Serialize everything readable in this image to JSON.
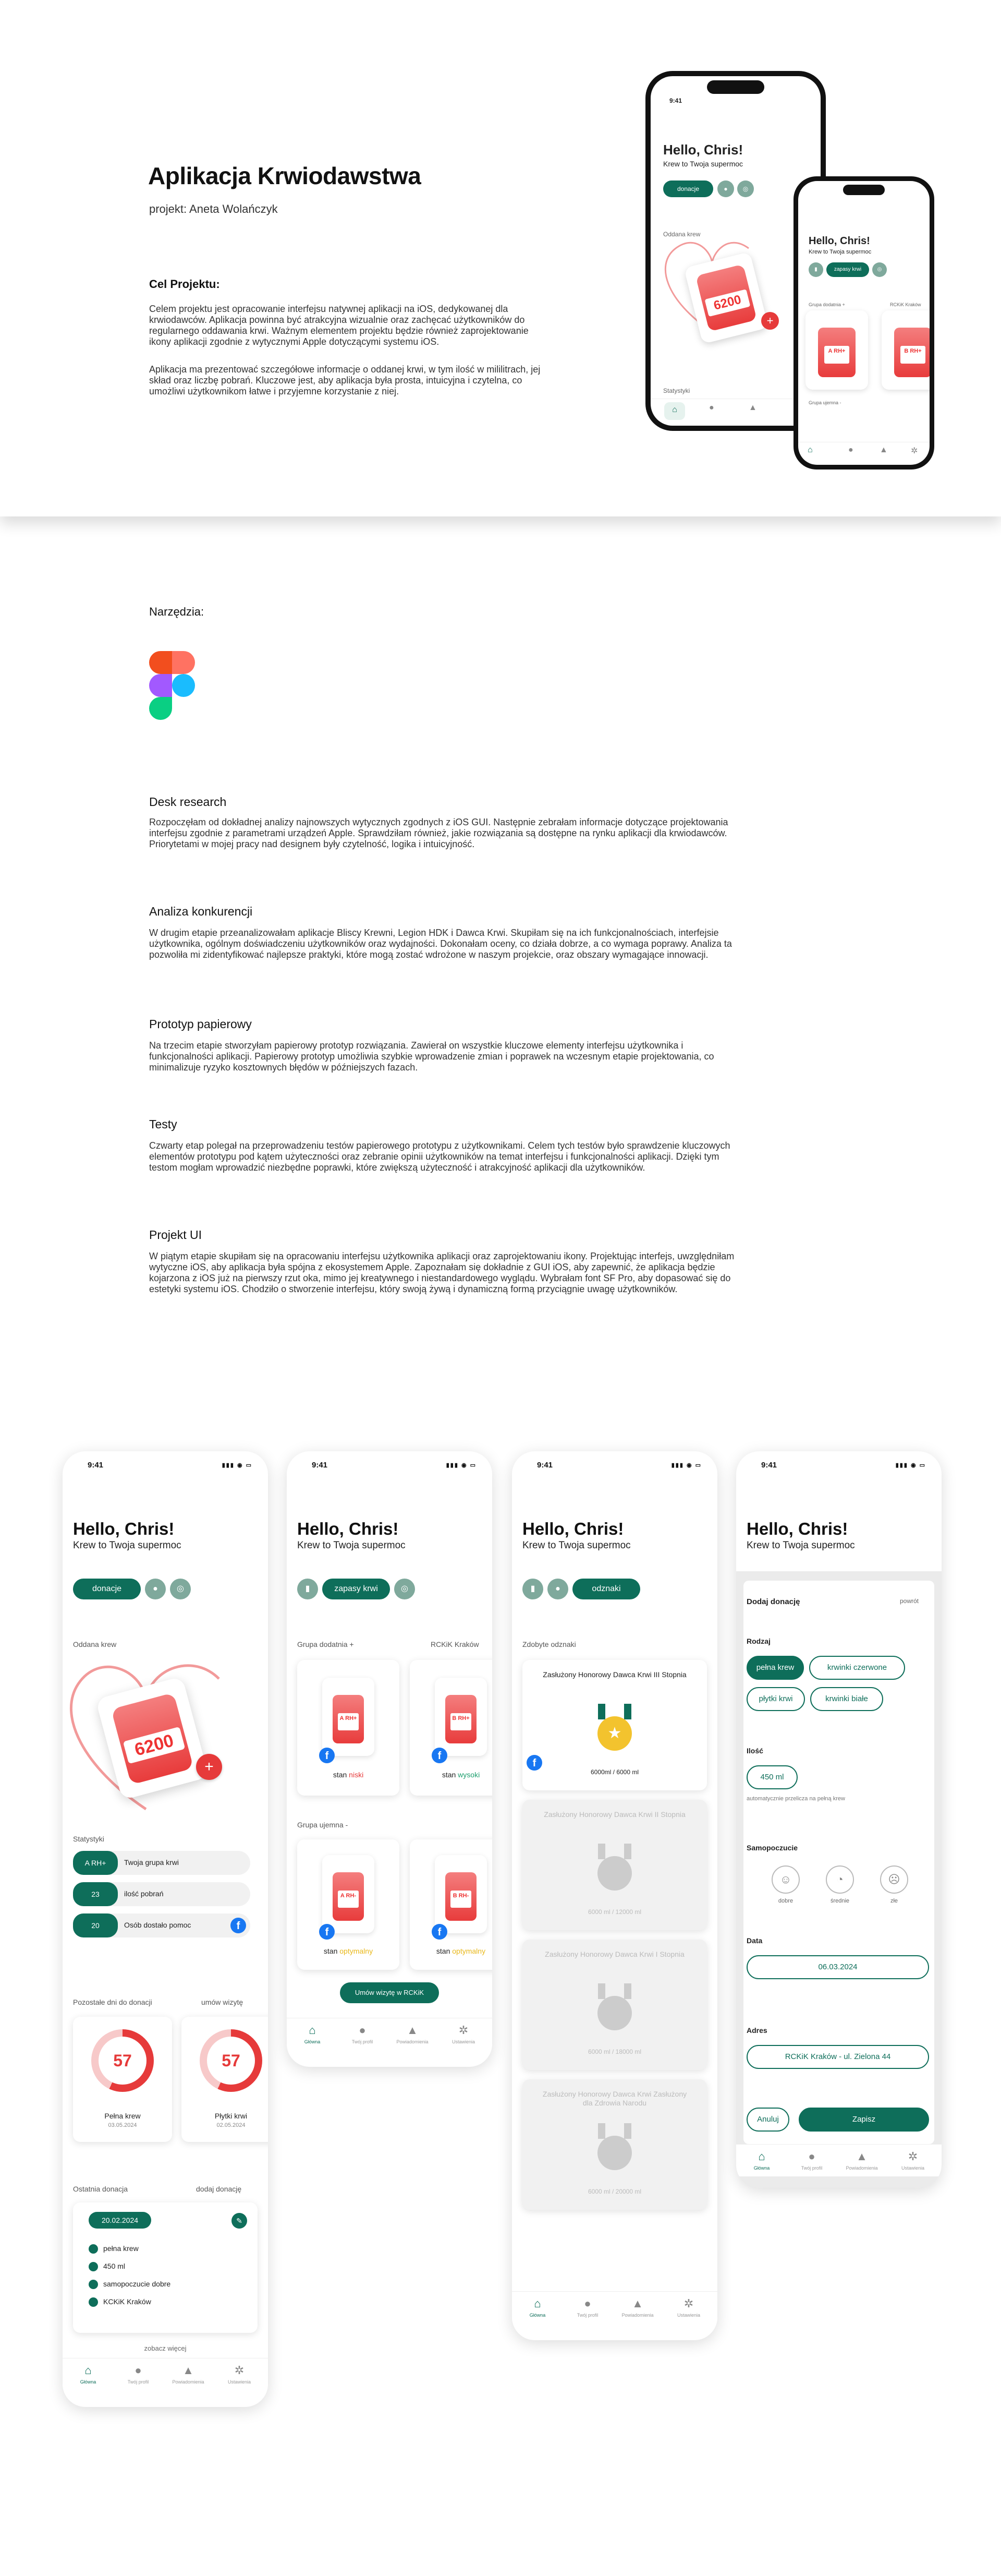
{
  "hero": {
    "title": "Aplikacja Krwiodawstwa",
    "author": "projekt: Aneta Wolańczyk",
    "goal_heading": "Cel Projektu:",
    "goal_text": "Celem projektu jest opracowanie interfejsu natywnej aplikacji na iOS, dedykowanej dla krwiodawców. Aplikacja powinna być atrakcyjna wizualnie oraz zachęcać użytkowników do regularnego oddawania krwi. Ważnym elementem projektu będzie również zaprojektowanie ikony aplikacji zgodnie z wytycznymi Apple dotyczącymi systemu iOS.",
    "goal_text2": "Aplikacja ma prezentować szczegółowe informacje o oddanej krwi, w tym ilość w mililitrach, jej skład oraz liczbę pobrań. Kluczowe jest, aby aplikacja była prosta, intuicyjna i czytelna, co umożliwi użytkownikom łatwe i przyjemne korzystanie z niej."
  },
  "tools": {
    "heading": "Narzędzia:"
  },
  "sections": [
    {
      "title": "Desk research",
      "text": "Rozpoczęłam od dokładnej analizy najnowszych wytycznych zgodnych z iOS GUI. Następnie zebrałam informacje dotyczące projektowania interfejsu zgodnie z parametrami urządzeń Apple. Sprawdziłam również, jakie rozwiązania są dostępne na rynku aplikacji dla krwiodawców. Priorytetami w mojej pracy nad designem były czytelność, logika i intuicyjność."
    },
    {
      "title": "Analiza konkurencji",
      "text": "W drugim etapie przeanalizowałam aplikacje Bliscy Krewni, Legion HDK i Dawca Krwi. Skupiłam się na ich funkcjonalnościach, interfejsie użytkownika, ogólnym doświadczeniu użytkowników oraz wydajności. Dokonałam oceny, co działa dobrze, a co wymaga poprawy. Analiza ta pozwoliła mi zidentyfikować najlepsze praktyki, które mogą zostać wdrożone w naszym projekcie, oraz obszary wymagające innowacji."
    },
    {
      "title": "Prototyp papierowy",
      "text": "Na trzecim etapie stworzyłam papierowy prototyp rozwiązania. Zawierał on wszystkie kluczowe elementy interfejsu użytkownika i funkcjonalności aplikacji. Papierowy prototyp umożliwia szybkie wprowadzenie zmian i poprawek na wczesnym etapie projektowania, co minimalizuje ryzyko kosztownych błędów w późniejszych fazach."
    },
    {
      "title": "Testy",
      "text": "Czwarty etap polegał na przeprowadzeniu testów papierowego prototypu z użytkownikami. Celem tych testów było sprawdzenie kluczowych elementów prototypu pod kątem użyteczności oraz zebranie opinii użytkowników na temat interfejsu i funkcjonalności aplikacji. Dzięki tym testom mogłam wprowadzić niezbędne poprawki, które zwiększą użyteczność i atrakcyjność aplikacji dla użytkowników."
    },
    {
      "title": "Projekt UI",
      "text": "W piątym etapie skupiłam się na opracowaniu interfejsu użytkownika aplikacji oraz zaprojektowaniu ikony. Projektując interfejs, uwzględniłam wytyczne iOS, aby aplikacja była spójna z ekosystemem Apple. Zapoznałam się dokładnie z GUI iOS, aby zapewnić, że aplikacja będzie kojarzona z iOS już na pierwszy rzut oka, mimo jej kreatywnego i niestandardowego wyglądu. Wybrałam font SF Pro, aby dopasować się do estetyki systemu iOS. Chodziło o stworzenie interfejsu, który swoją żywą i dynamiczną formą przyciągnie uwagę użytkowników."
    }
  ],
  "app": {
    "time": "9:41",
    "hello": "Hello, Chris!",
    "tagline": "Krew to Twoja supermoc",
    "btn_donate": "donacje",
    "btn_stocks": "zapasy krwi",
    "btn_badges": "odznaki",
    "donated": "Oddana krew",
    "donated_value": "6200",
    "donated_unit": "ml",
    "stats": "Statystyki",
    "stat_rows": [
      {
        "v": "A RH+",
        "l": "Twoja grupa krwi"
      },
      {
        "v": "23",
        "l": "ilość pobrań"
      },
      {
        "v": "20",
        "l": "Osób dostało pomoc"
      }
    ],
    "days_left": "Pozostałe dni do donacji",
    "remind": "umów wizytę",
    "gauges": [
      {
        "v": "57",
        "l": "Pełna krew",
        "d": "03.05.2024"
      },
      {
        "v": "57",
        "l": "Płytki krwi",
        "d": "02.05.2024"
      }
    ],
    "last": "Ostatnia donacja",
    "add": "dodaj donację",
    "last_date": "20.02.2024",
    "last_rows": [
      "pełna krew",
      "450 ml",
      "samopoczucie dobre",
      "KCKiK Kraków"
    ],
    "more": "zobacz więcej",
    "tabs": [
      "Główna",
      "Twój profil",
      "Powiadomienia",
      "Ustawienia"
    ],
    "grp_pos": "Grupa dodatnia +",
    "grp_neg": "Grupa ujemna -",
    "center": "RCKiK Kraków",
    "blood": [
      {
        "t": "A RH+",
        "s": "niski",
        "c": "#e63a3a"
      },
      {
        "t": "B RH+",
        "s": "wysoki",
        "c": "#1d9f6e"
      },
      {
        "t": "A RH-",
        "s": "optymalny",
        "c": "#e9b81a"
      },
      {
        "t": "B RH-",
        "s": "optymalny",
        "c": "#e9b81a"
      }
    ],
    "stan": "stan",
    "book_rckik": "Umów wizytę w RCKiK",
    "badges_h": "Zdobyte odznaki",
    "badges": [
      {
        "title": "Zasłużony Honorowy Dawca Krwi III Stopnia",
        "p": "6000ml / 6000 ml",
        "on": true
      },
      {
        "title": "Zasłużony Honorowy Dawca Krwi II Stopnia",
        "p": "6000 ml / 12000 ml",
        "on": false
      },
      {
        "title": "Zasłużony Honorowy Dawca Krwi I Stopnia",
        "p": "6000 ml / 18000 ml",
        "on": false
      },
      {
        "title": "Zasłużony Honorowy Dawca Krwi Zasłużony dla Zdrowia Narodu",
        "p": "6000 ml / 20000 ml",
        "on": false
      }
    ],
    "form_title": "Dodaj donację",
    "form_back": "powrót",
    "kind": "Rodzaj",
    "kinds": [
      "pełna krew",
      "krwinki czerwone",
      "płytki krwi",
      "krwinki białe"
    ],
    "amount": "Ilość",
    "amount_v": "450 ml",
    "amount_hint": "automatycznie przelicza na pełną krew",
    "mood": "Samopoczucie",
    "moods": [
      "dobre",
      "średnie",
      "złe"
    ],
    "date": "Data",
    "date_v": "06.03.2024",
    "addr": "Adres",
    "addr_v": "RCKiK Kraków - ul. Zielona 44",
    "cancel": "Anuluj",
    "save": "Zapisz"
  },
  "colors": {
    "accent": "#0e6e5a",
    "red": "#e63a3a"
  }
}
